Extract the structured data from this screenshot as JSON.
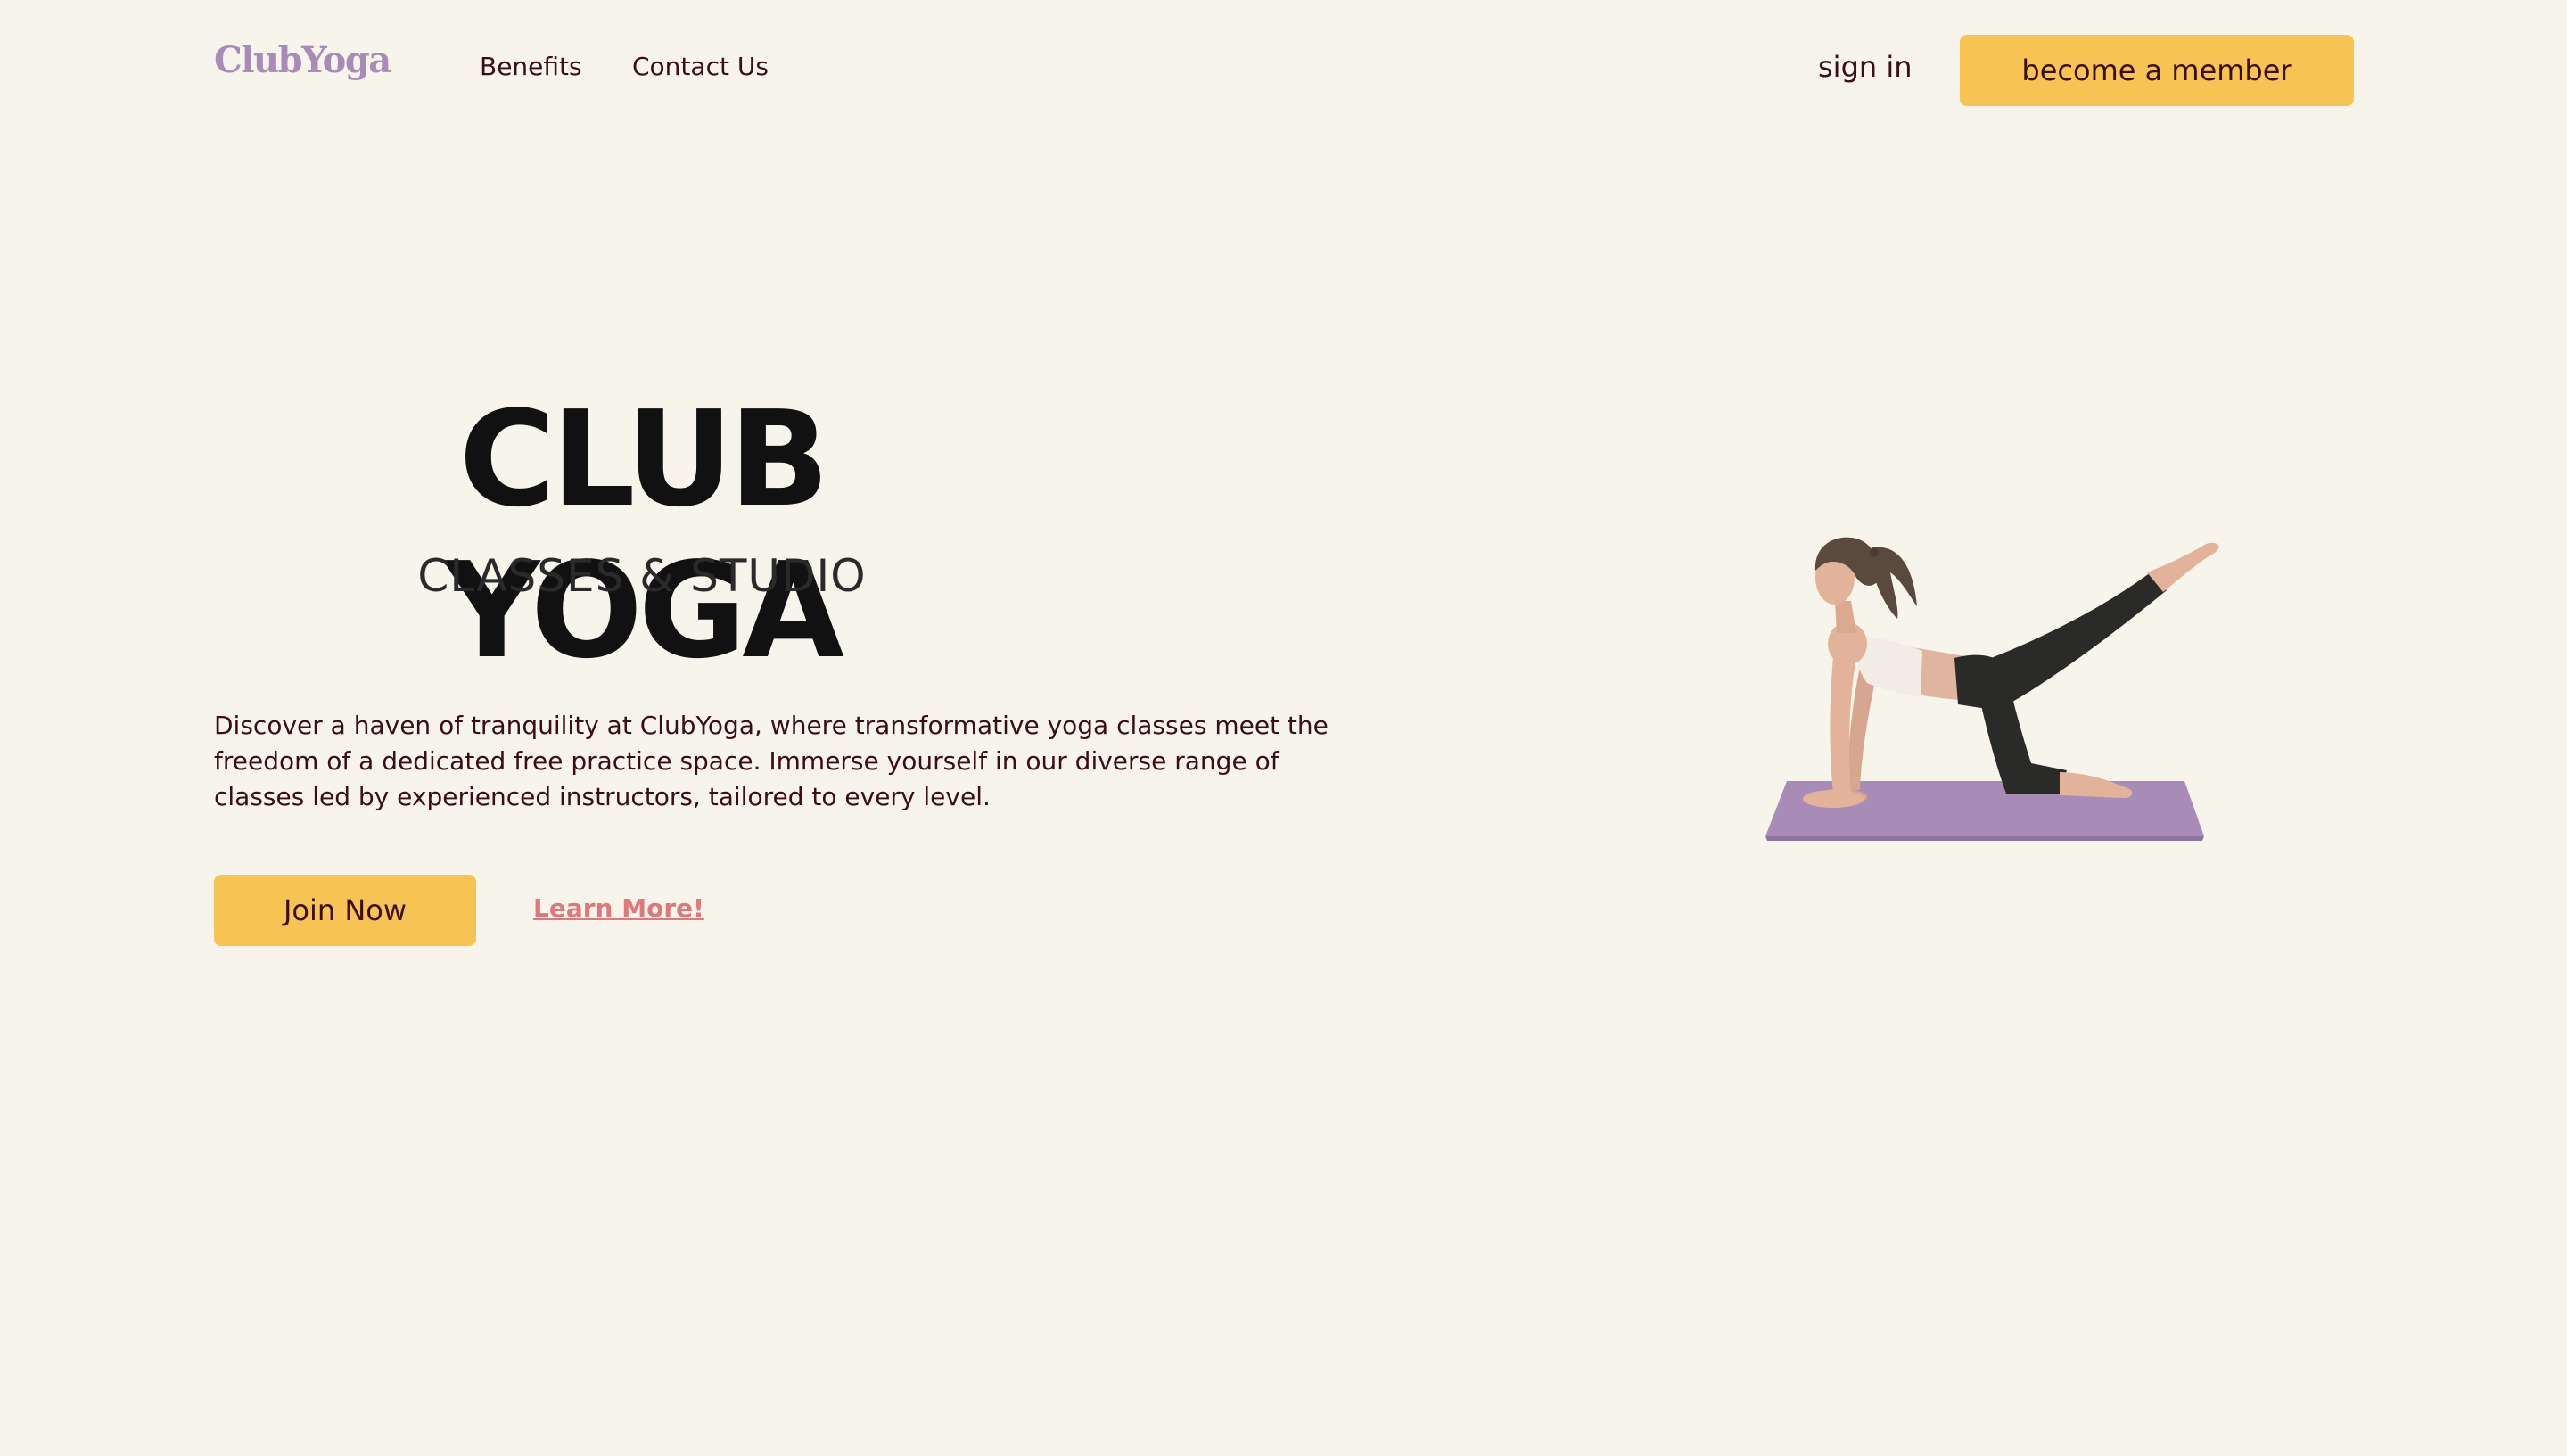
{
  "header": {
    "logo": "ClubYoga",
    "nav": {
      "benefits": "Benefits",
      "contact": "Contact Us"
    },
    "sign_in": "sign in",
    "cta": "become a member"
  },
  "hero": {
    "title": "CLUB YOGA",
    "subtitle": "CLASSES & STUDIO",
    "description": "Discover a haven of tranquility at ClubYoga, where transformative yoga classes meet the freedom of a dedicated free practice space. Immerse yourself in our diverse range of classes led by experienced instructors, tailored to every level.",
    "join_label": "Join Now",
    "learn_more_label": "Learn More!"
  },
  "illustration": {
    "icon": "woman-yoga-pose-illustration"
  },
  "colors": {
    "background": "#f7f4ec",
    "accent_yellow": "#f7c353",
    "text_dark": "#3b0f12",
    "logo_purple": "#a98bb8",
    "link_pink": "#e0777a",
    "mat_purple": "#a98bb8"
  }
}
